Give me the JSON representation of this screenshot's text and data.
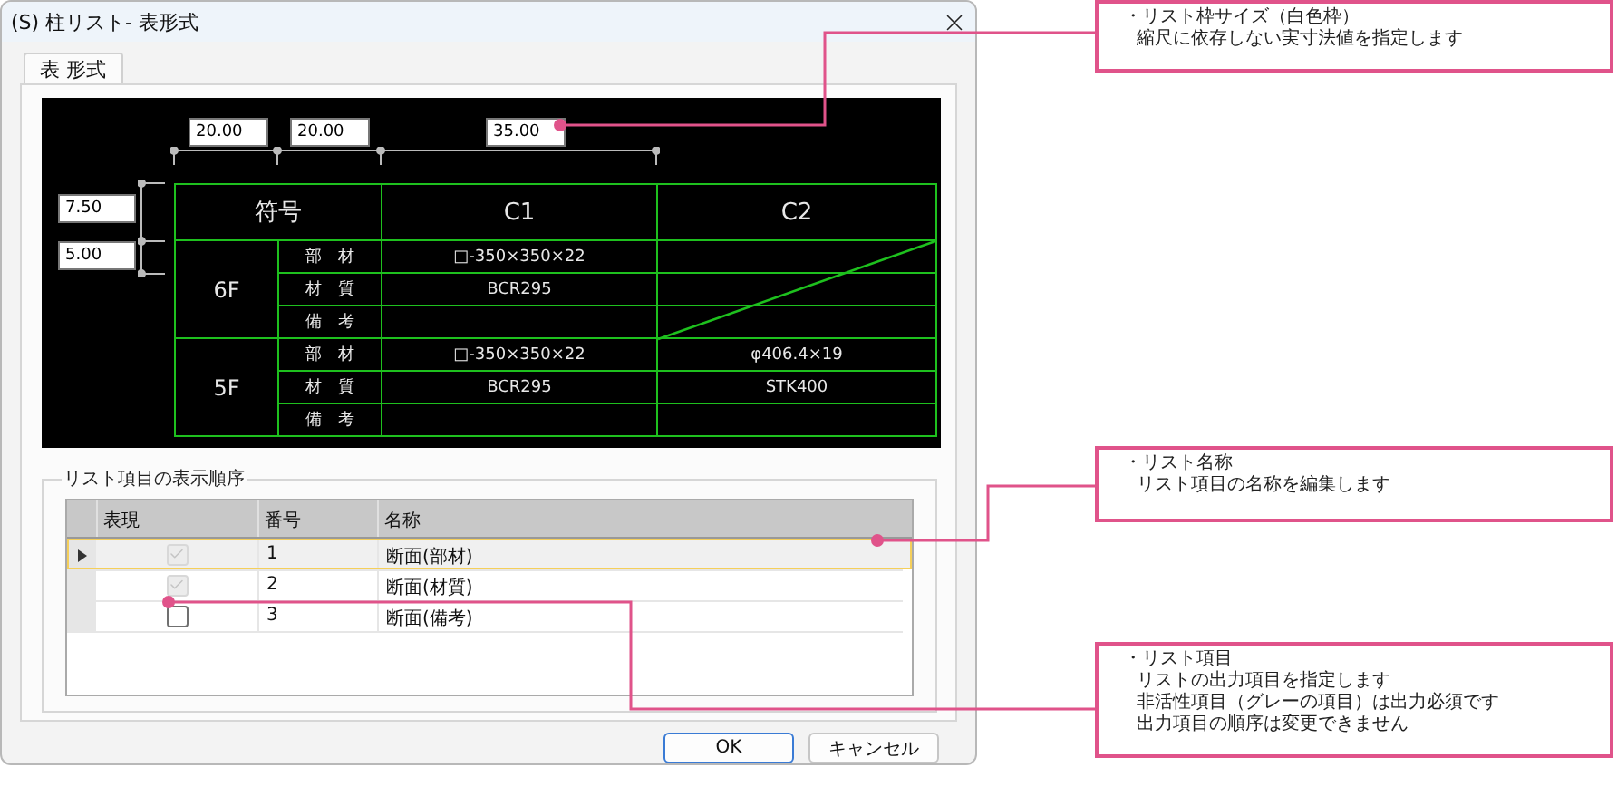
{
  "window": {
    "title": "(S) 柱リスト- 表形式"
  },
  "tabs": [
    {
      "label": "表 形式",
      "selected": true
    }
  ],
  "preview": {
    "column_widths": [
      "20.00",
      "20.00",
      "35.00"
    ],
    "row_heights": [
      "7.50",
      "5.00"
    ],
    "symbol_header": "符号",
    "columns": [
      "C1",
      "C2"
    ],
    "floors": [
      {
        "label": "6F",
        "crossed": [
          false,
          true
        ],
        "rows": [
          {
            "item": "部　材",
            "column_1": "□-350×350×22"
          },
          {
            "item": "材　質",
            "column_1": "BCR295"
          },
          {
            "item": "備　考"
          }
        ]
      },
      {
        "label": "5F",
        "crossed": [
          false,
          false
        ],
        "rows": [
          {
            "item": "部　材",
            "column_1": "□-350×350×22",
            "column_2": "φ406.4×19"
          },
          {
            "item": "材　質",
            "column_1": "BCR295",
            "column_2": "STK400"
          },
          {
            "item": "備　考"
          }
        ]
      }
    ]
  },
  "order_group": {
    "title": "リスト項目の表示順序",
    "columns": [
      "表現",
      "番号",
      "名称"
    ],
    "rows": [
      {
        "checked": true,
        "disabled": true,
        "number": "1",
        "name": "断面(部材)",
        "selected": true
      },
      {
        "checked": true,
        "disabled": true,
        "number": "2",
        "name": "断面(材質)",
        "selected": false
      },
      {
        "checked": false,
        "disabled": false,
        "number": "3",
        "name": "断面(備考)",
        "selected": false
      }
    ]
  },
  "buttons": [
    {
      "label": "OK",
      "default": true
    },
    {
      "label": "キャンセル",
      "default": false
    }
  ],
  "callouts": [
    {
      "title": "・リスト枠サイズ（白色枠）",
      "lines": [
        "縮尺に依存しない実寸法値を指定します"
      ]
    },
    {
      "title": "・リスト名称",
      "lines": [
        "リスト項目の名称を編集します"
      ]
    },
    {
      "title": "・リスト項目",
      "lines": [
        "リストの出力項目を指定します",
        "非活性項目（グレーの項目）は出力必須です",
        "出力項目の順序は変更できません"
      ]
    }
  ]
}
